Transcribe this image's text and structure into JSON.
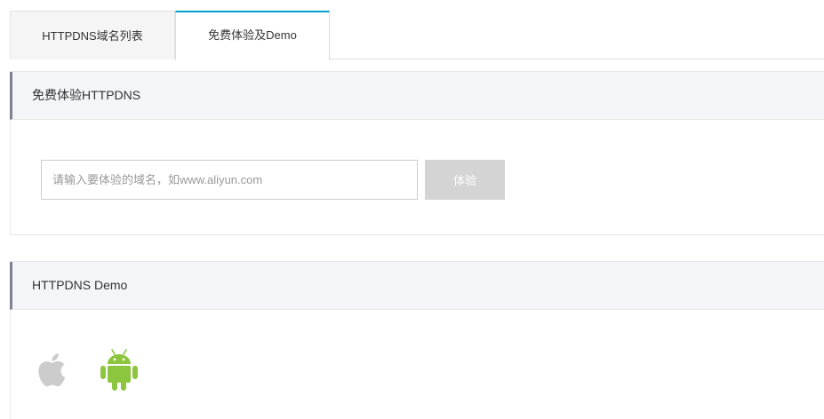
{
  "tabs": [
    {
      "label": "HTTPDNS域名列表",
      "active": false
    },
    {
      "label": "免费体验及Demo",
      "active": true
    }
  ],
  "trial": {
    "title": "免费体验HTTPDNS",
    "input_placeholder": "请输入要体验的域名，如www.aliyun.com",
    "input_value": "",
    "button_label": "体验"
  },
  "demo": {
    "title": "HTTPDNS Demo",
    "platforms": [
      {
        "icon": "apple-icon",
        "color": "#cccccc"
      },
      {
        "icon": "android-icon",
        "color": "#8cc63e"
      }
    ]
  },
  "colors": {
    "active_tab_accent": "#00a2ca",
    "header_bg": "#f4f5f9",
    "header_accent": "#80808e",
    "button_disabled": "#d4d4d4"
  }
}
